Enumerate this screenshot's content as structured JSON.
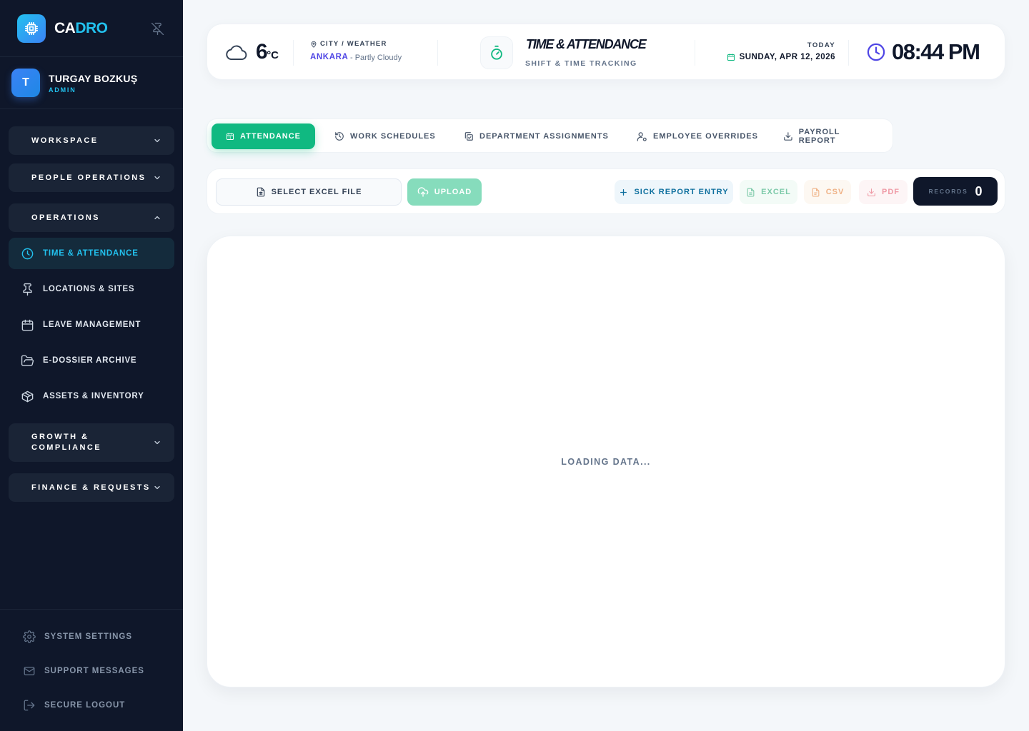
{
  "brand": {
    "name_a": "CA",
    "name_b": "DRO"
  },
  "user": {
    "initial": "T",
    "name": "TURGAY BOZKUŞ",
    "role": "ADMIN"
  },
  "nav": {
    "workspace": "WORKSPACE",
    "people_operations": "PEOPLE OPERATIONS",
    "operations": "OPERATIONS",
    "items": [
      {
        "label": "TIME & ATTENDANCE"
      },
      {
        "label": "LOCATIONS & SITES"
      },
      {
        "label": "LEAVE MANAGEMENT"
      },
      {
        "label": "E-DOSSIER ARCHIVE"
      },
      {
        "label": "ASSETS & INVENTORY"
      }
    ],
    "growth_line1": "GROWTH &",
    "growth_line2": "COMPLIANCE",
    "finance": "FINANCE & REQUESTS"
  },
  "footer": {
    "settings": "SYSTEM SETTINGS",
    "messages": "SUPPORT MESSAGES",
    "logout": "SECURE LOGOUT"
  },
  "header": {
    "temperature": "6",
    "temperature_unit": "°C",
    "city_weather_label": "CITY / WEATHER",
    "city": "ANKARA",
    "condition": "- Partly Cloudy",
    "title": "TIME & ATTENDANCE",
    "subtitle": "SHIFT & TIME TRACKING",
    "today_label": "TODAY",
    "date": "SUNDAY, APR 12, 2026",
    "time": "08:44 PM"
  },
  "tabs": [
    {
      "label": "ATTENDANCE"
    },
    {
      "label": "WORK SCHEDULES"
    },
    {
      "label": "DEPARTMENT ASSIGNMENTS"
    },
    {
      "label": "EMPLOYEE OVERRIDES"
    },
    {
      "label": "PAYROLL REPORT"
    }
  ],
  "toolbar": {
    "select_file": "SELECT EXCEL FILE",
    "upload": "UPLOAD",
    "sick_report": "SICK REPORT ENTRY",
    "excel": "EXCEL",
    "csv": "CSV",
    "pdf": "PDF",
    "records_label": "RECORDS",
    "records_count": "0"
  },
  "content": {
    "loading": "LOADING DATA..."
  },
  "colors": {
    "sidebar_bg": "#0f172a",
    "accent_cyan": "#22c1ee",
    "accent_green": "#10b981",
    "accent_indigo": "#4f46e5"
  }
}
